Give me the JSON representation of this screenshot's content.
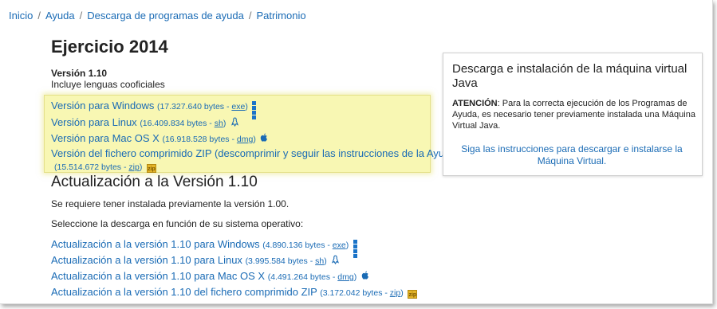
{
  "breadcrumb": {
    "items": [
      "Inicio",
      "Ayuda",
      "Descarga de programas de ayuda",
      "Patrimonio"
    ],
    "separator": "/"
  },
  "page": {
    "title": "Ejercicio 2014",
    "version_label": "Versión 1.10",
    "version_sub": "Incluye lenguas cooficiales"
  },
  "downloads": [
    {
      "label": "Versión para Windows",
      "meta_prefix": "(17.327.640 bytes - ",
      "ext": "exe",
      "meta_suffix": ")",
      "icon": "windows-icon"
    },
    {
      "label": "Versión para Linux",
      "meta_prefix": "(16.409.834 bytes - ",
      "ext": "sh",
      "meta_suffix": ")",
      "icon": "linux-icon"
    },
    {
      "label": "Versión para Mac OS X",
      "meta_prefix": "(16.918.528 bytes - ",
      "ext": "dmg",
      "meta_suffix": ")",
      "icon": "apple-icon"
    },
    {
      "label": "Versión del fichero comprimido ZIP (descomprimir y seguir las instrucciones de la Ayuda)",
      "meta_prefix": "(15.514.672 bytes - ",
      "ext": "zip",
      "meta_suffix": ")",
      "icon": "zip-icon"
    }
  ],
  "update": {
    "heading": "Actualización a la Versión 1.10",
    "note": "Se requiere tener instalada previamente la versión 1.00.",
    "select_text": "Seleccione la descarga en función de su sistema operativo:",
    "links": [
      {
        "label": "Actualización a la versión 1.10 para Windows",
        "meta_prefix": "(4.890.136 bytes - ",
        "ext": "exe",
        "meta_suffix": ")",
        "icon": "windows-icon"
      },
      {
        "label": "Actualización a la versión 1.10 para Linux",
        "meta_prefix": "(3.995.584 bytes - ",
        "ext": "sh",
        "meta_suffix": ")",
        "icon": "linux-icon"
      },
      {
        "label": "Actualización a la versión 1.10 para Mac OS X",
        "meta_prefix": "(4.491.264 bytes - ",
        "ext": "dmg",
        "meta_suffix": ")",
        "icon": "apple-icon"
      },
      {
        "label": "Actualización a la versión 1.10 del fichero comprimido ZIP",
        "meta_prefix": "(3.172.042 bytes - ",
        "ext": "zip",
        "meta_suffix": ")",
        "icon": "zip-icon"
      }
    ]
  },
  "sidebar_card": {
    "title": "Descarga e instalación de la máquina virtual Java",
    "attention_label": "ATENCIÓN",
    "attention_text": ": Para la correcta ejecución de los Programas de Ayuda, es necesario tener previamente instalada una Máquina Virtual Java.",
    "link": "Siga las instrucciones para descargar e instalarse la Máquina Virtual."
  },
  "colors": {
    "link": "#1a6bb5",
    "highlight": "#f8f7b3",
    "windows": "#1a73c8",
    "zip": "#e3b428"
  },
  "zip_icon_text": "zip"
}
